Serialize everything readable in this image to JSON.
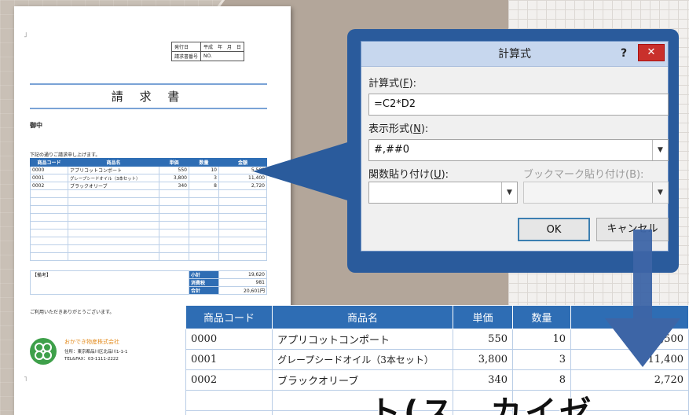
{
  "invoice": {
    "issue_date_label": "発行日",
    "issue_date_value": "平成　年　月　日",
    "number_label": "請求書番号",
    "number_value": "NO.",
    "title": "請 求 書",
    "to": "御中",
    "intro": "下記の通りご請求申し上げます。",
    "headers": [
      "商品コード",
      "商品名",
      "単価",
      "数量",
      "金額"
    ],
    "rows": [
      [
        "0000",
        "アプリコットコンポート",
        "550",
        "10",
        "5,500"
      ],
      [
        "0001",
        "グレープシードオイル（3本セット）",
        "3,800",
        "3",
        "11,400"
      ],
      [
        "0002",
        "ブラックオリーブ",
        "340",
        "8",
        "2,720"
      ]
    ],
    "remarks_label": "【備考】",
    "subtotal_label": "小計",
    "subtotal": "19,620",
    "tax_label": "消費税",
    "tax": "981",
    "total_label": "合計",
    "total": "20,601円",
    "thanks": "ご利用いただきありがとうございます。",
    "company": "おかでき物産株式会社",
    "address": "住所：東京都品川区北品川1-1-1",
    "tel": "TEL&FAX：03-1111-2222"
  },
  "dialog": {
    "title": "計算式",
    "help": "?",
    "close": "✕",
    "formula_label": "計算式(",
    "formula_key": "F",
    "formula_end": "):",
    "formula_value": "=C2*D2",
    "format_label": "表示形式(",
    "format_key": "N",
    "format_end": "):",
    "format_value": "#,##0",
    "func_label": "関数貼り付け(",
    "func_key": "U",
    "func_end": "):",
    "bookmark_label": "ブックマーク貼り付け(B):",
    "ok": "OK",
    "cancel": "キャンセル"
  },
  "zoom": {
    "headers": [
      "商品コード",
      "商品名",
      "単価",
      "数量",
      ""
    ],
    "rows": [
      [
        "0000",
        "アプリコットコンポート",
        "550",
        "10",
        "5,500"
      ],
      [
        "0001",
        "グレープシードオイル（3本セット）",
        "3,800",
        "3",
        "11,400"
      ],
      [
        "0002",
        "ブラックオリーブ",
        "340",
        "8",
        "2,720"
      ]
    ]
  },
  "overlay_text": "ト(ス　カイゼ",
  "colors": {
    "accent": "#2e6db4",
    "close": "#c9302c",
    "logo": "#3ea04a"
  }
}
